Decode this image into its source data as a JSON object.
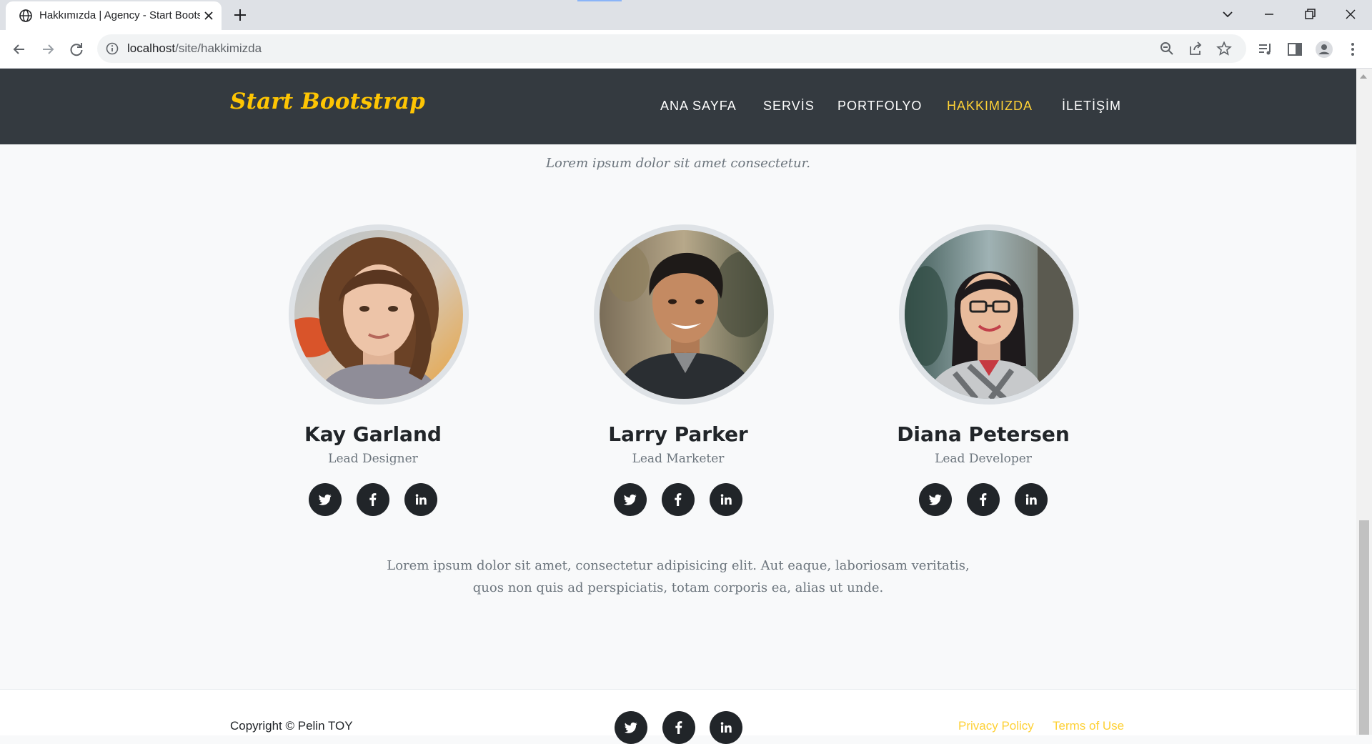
{
  "browser": {
    "tab_title": "Hakkımızda | Agency - Start Bootstrap",
    "url_host": "localhost",
    "url_path": "/site/hakkimizda"
  },
  "nav": {
    "brand": "Start Bootstrap",
    "links": [
      {
        "label": "ANA SAYFA",
        "active": false
      },
      {
        "label": "SERVİS",
        "active": false
      },
      {
        "label": "PORTFOLYO",
        "active": false
      },
      {
        "label": "HAKKIMIZDA",
        "active": true
      },
      {
        "label": "İLETİŞİM",
        "active": false
      }
    ]
  },
  "team": {
    "subheading": "Lorem ipsum dolor sit amet consectetur.",
    "members": [
      {
        "name": "Kay Garland",
        "role": "Lead Designer",
        "socials": [
          "twitter-icon",
          "facebook-icon",
          "linkedin-icon"
        ]
      },
      {
        "name": "Larry Parker",
        "role": "Lead Marketer",
        "socials": [
          "twitter-icon",
          "facebook-icon",
          "linkedin-icon"
        ]
      },
      {
        "name": "Diana Petersen",
        "role": "Lead Developer",
        "socials": [
          "twitter-icon",
          "facebook-icon",
          "linkedin-icon"
        ]
      }
    ],
    "lead_text": "Lorem ipsum dolor sit amet, consectetur adipisicing elit. Aut eaque, laboriosam veritatis, quos non quis ad perspiciatis, totam corporis ea, alias ut unde."
  },
  "footer": {
    "copyright": "Copyright © Pelin TOY",
    "socials": [
      "twitter-icon",
      "facebook-icon",
      "linkedin-icon"
    ],
    "privacy": "Privacy Policy",
    "terms": "Terms of Use"
  },
  "colors": {
    "navbar_bg": "#343a40",
    "accent": "#fed136",
    "page_bg": "#f8f9fa",
    "social_bg": "#212529"
  }
}
